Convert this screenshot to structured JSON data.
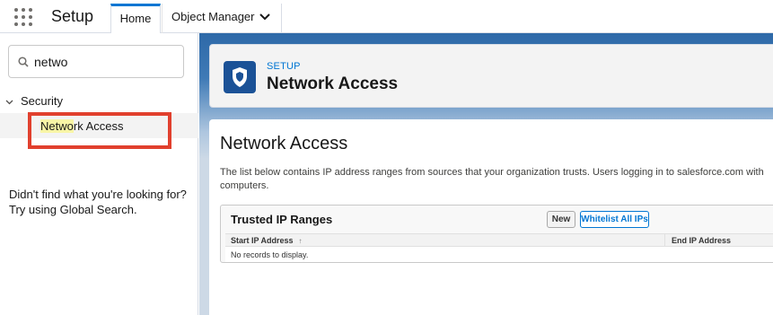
{
  "app": {
    "name": "Setup"
  },
  "tabs": [
    {
      "label": "Home"
    },
    {
      "label": "Object Manager"
    }
  ],
  "sidebar": {
    "search_value": "netwo",
    "tree": {
      "parent_label": "Security",
      "child_label_match": "Netwo",
      "child_label_rest": "rk Access"
    },
    "help_text": "Didn't find what you're looking for? Try using Global Search."
  },
  "header": {
    "eyebrow": "SETUP",
    "title": "Network Access"
  },
  "content": {
    "title": "Network Access",
    "description": "The list below contains IP address ranges from sources that your organization trusts. Users logging in to salesforce.com with computers.",
    "related_list": {
      "title": "Trusted IP Ranges",
      "new_button": "New",
      "whitelist_button": "Whitelist All IPs",
      "columns": [
        "Start IP Address",
        "End IP Address"
      ],
      "sort_indicator": "↑",
      "empty_message": "No records to display."
    }
  },
  "colors": {
    "brand_blue": "#0176d3",
    "highlight_box": "#e1402e",
    "match_highlight": "#f8f5a6",
    "header_icon_bg": "#1b5297"
  },
  "icons": [
    "app-launcher-icon",
    "chevron-down-icon",
    "search-icon",
    "chevron-down-icon",
    "shield-icon",
    "sort-up-icon"
  ]
}
